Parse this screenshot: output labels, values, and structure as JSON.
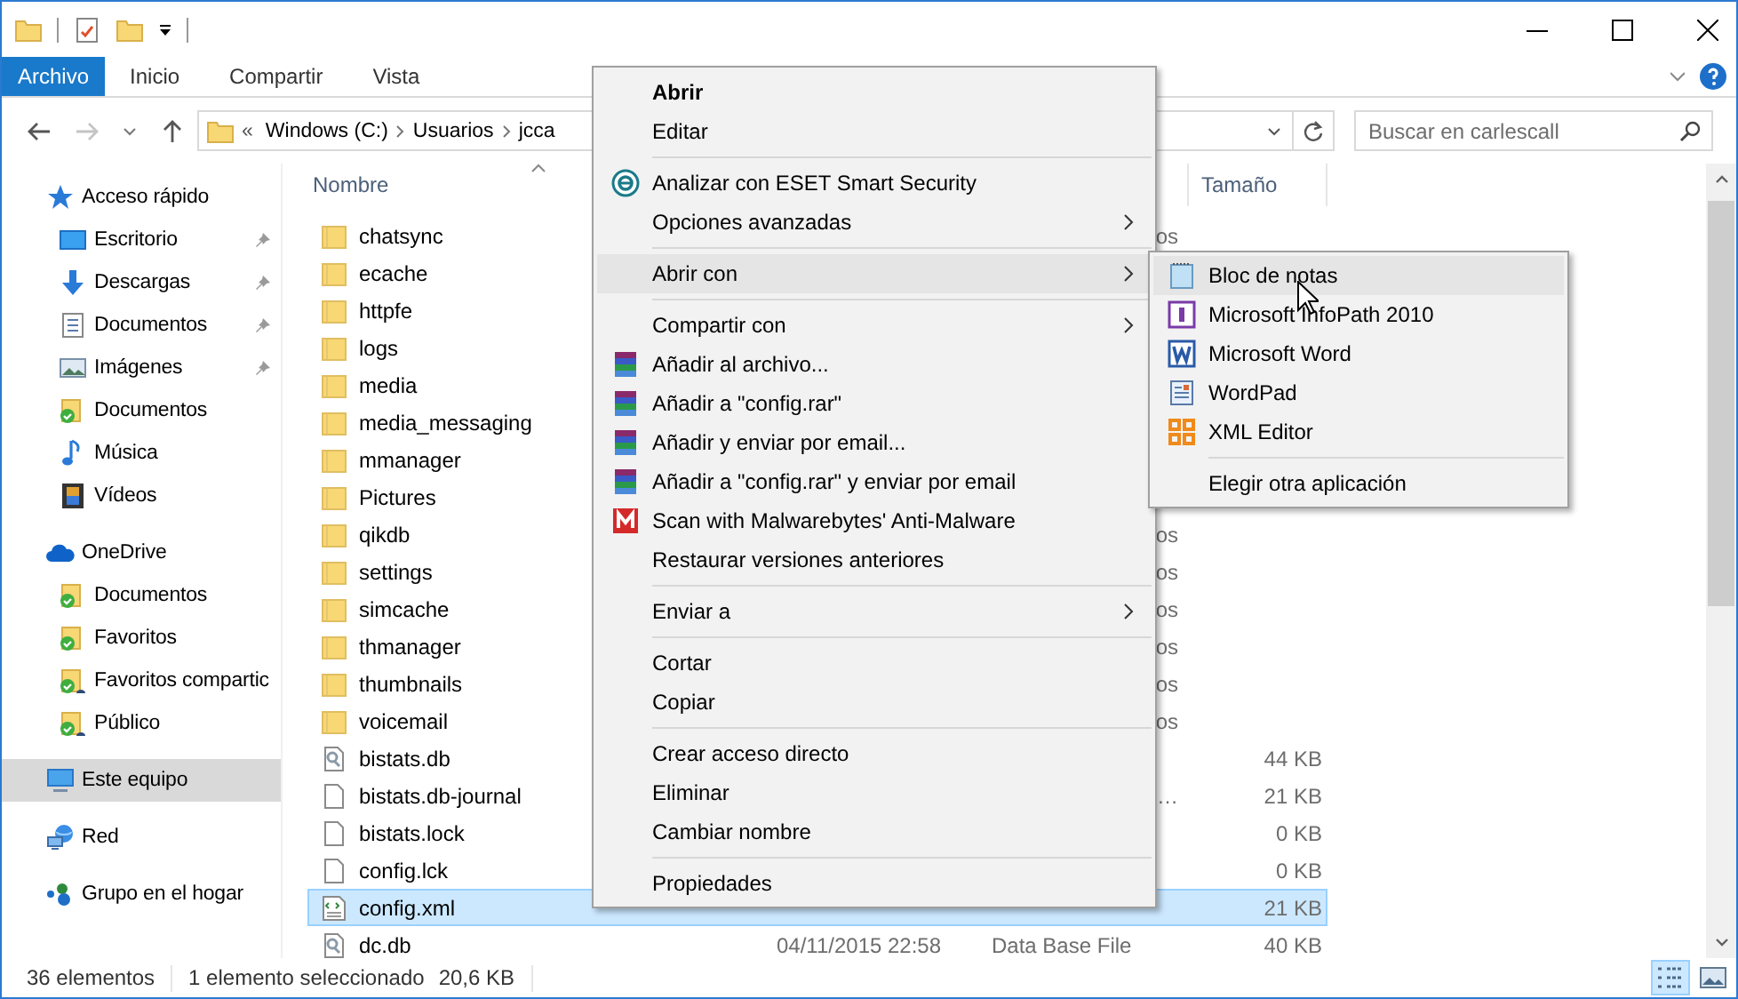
{
  "ribbon": {
    "tabs": [
      {
        "label": "Archivo",
        "selected": true
      },
      {
        "label": "Inicio",
        "selected": false
      },
      {
        "label": "Compartir",
        "selected": false
      },
      {
        "label": "Vista",
        "selected": false
      }
    ]
  },
  "address_bar": {
    "back": {
      "disabled": false
    },
    "forward": {
      "disabled": true
    },
    "overflow_mark": "«",
    "path": [
      "Windows (C:)",
      "Usuarios",
      "jcca"
    ]
  },
  "search": {
    "placeholder": "Buscar en carlescall"
  },
  "nav_pane": {
    "items": [
      {
        "label": "Acceso rápido",
        "kind": "star",
        "selected": false,
        "children": [
          {
            "label": "Escritorio",
            "kind": "desktop",
            "pinned": true,
            "selected": false
          },
          {
            "label": "Descargas",
            "kind": "download",
            "pinned": true,
            "selected": false
          },
          {
            "label": "Documentos",
            "kind": "documents",
            "pinned": true,
            "selected": false
          },
          {
            "label": "Imágenes",
            "kind": "images",
            "pinned": true,
            "selected": false
          },
          {
            "label": "Documentos",
            "kind": "synced",
            "pinned": false,
            "selected": false
          },
          {
            "label": "Música",
            "kind": "music",
            "pinned": false,
            "selected": false
          },
          {
            "label": "Vídeos",
            "kind": "video",
            "pinned": false,
            "selected": false
          }
        ]
      },
      {
        "label": "OneDrive",
        "kind": "cloud",
        "selected": false,
        "children": [
          {
            "label": "Documentos",
            "kind": "synced",
            "pinned": false,
            "selected": false
          },
          {
            "label": "Favoritos",
            "kind": "synced",
            "pinned": false,
            "selected": false
          },
          {
            "label": "Favoritos compartic",
            "kind": "shared",
            "pinned": false,
            "selected": false
          },
          {
            "label": "Público",
            "kind": "shared",
            "pinned": false,
            "selected": false
          }
        ]
      },
      {
        "label": "Este equipo",
        "kind": "computer",
        "selected": true
      },
      {
        "label": "Red",
        "kind": "network",
        "selected": false
      },
      {
        "label": "Grupo en el hogar",
        "kind": "homegroup",
        "selected": false
      }
    ]
  },
  "file_list": {
    "columns": [
      {
        "label": "Nombre",
        "sorted": true
      },
      {
        "label": "Tamaño",
        "sorted": false
      }
    ],
    "rows": [
      {
        "name": "chatsync",
        "kind": "folder",
        "selected": false,
        "type_tail": "os"
      },
      {
        "name": "ecache",
        "kind": "folder",
        "selected": false
      },
      {
        "name": "httpfe",
        "kind": "folder",
        "selected": false
      },
      {
        "name": "logs",
        "kind": "folder",
        "selected": false
      },
      {
        "name": "media",
        "kind": "folder",
        "selected": false
      },
      {
        "name": "media_messaging",
        "kind": "folder",
        "selected": false
      },
      {
        "name": "mmanager",
        "kind": "folder",
        "selected": false
      },
      {
        "name": "Pictures",
        "kind": "folder",
        "selected": false
      },
      {
        "name": "qikdb",
        "kind": "folder",
        "selected": false,
        "type_tail": "os"
      },
      {
        "name": "settings",
        "kind": "folder",
        "selected": false,
        "type_tail": "os"
      },
      {
        "name": "simcache",
        "kind": "folder",
        "selected": false,
        "type_tail": "os"
      },
      {
        "name": "thmanager",
        "kind": "folder",
        "selected": false,
        "type_tail": "os"
      },
      {
        "name": "thumbnails",
        "kind": "folder",
        "selected": false,
        "type_tail": "os"
      },
      {
        "name": "voicemail",
        "kind": "folder",
        "selected": false,
        "type_tail": "os"
      },
      {
        "name": "bistats.db",
        "kind": "database",
        "selected": false,
        "size": "44 KB"
      },
      {
        "name": "bistats.db-journal",
        "kind": "file",
        "selected": false,
        "type_tail": "…",
        "size": "21 KB"
      },
      {
        "name": "bistats.lock",
        "kind": "file",
        "selected": false,
        "size": "0 KB"
      },
      {
        "name": "config.lck",
        "kind": "file",
        "selected": false,
        "size": "0 KB"
      },
      {
        "name": "config.xml",
        "kind": "xml",
        "selected": true,
        "size": "21 KB"
      },
      {
        "name": "dc.db",
        "kind": "database",
        "selected": false,
        "modified": "04/11/2015 22:58",
        "type": "Data Base File",
        "size": "40 KB"
      }
    ]
  },
  "context_menu": {
    "items": [
      {
        "kind": "item",
        "label": "Abrir",
        "default": true,
        "selected": false,
        "has_submenu": false
      },
      {
        "kind": "item",
        "label": "Editar",
        "default": false,
        "selected": false,
        "has_submenu": false
      },
      {
        "kind": "separator"
      },
      {
        "kind": "eset",
        "label": "Analizar con ESET Smart Security",
        "default": false,
        "selected": false,
        "has_submenu": false
      },
      {
        "kind": "item",
        "label": "Opciones avanzadas",
        "default": false,
        "selected": false,
        "has_submenu": true
      },
      {
        "kind": "separator"
      },
      {
        "kind": "item",
        "label": "Abrir con",
        "default": false,
        "selected": true,
        "has_submenu": true
      },
      {
        "kind": "separator"
      },
      {
        "kind": "item",
        "label": "Compartir con",
        "default": false,
        "selected": false,
        "has_submenu": true
      },
      {
        "kind": "archive",
        "label": "Añadir al archivo...",
        "default": false,
        "selected": false,
        "has_submenu": false
      },
      {
        "kind": "archive",
        "label": "Añadir a \"config.rar\"",
        "default": false,
        "selected": false,
        "has_submenu": false
      },
      {
        "kind": "archive",
        "label": "Añadir y enviar por email...",
        "default": false,
        "selected": false,
        "has_submenu": false
      },
      {
        "kind": "archive",
        "label": "Añadir a \"config.rar\" y enviar por email",
        "default": false,
        "selected": false,
        "has_submenu": false
      },
      {
        "kind": "malware",
        "label": "Scan with Malwarebytes' Anti-Malware",
        "default": false,
        "selected": false,
        "has_submenu": false
      },
      {
        "kind": "item",
        "label": "Restaurar versiones anteriores",
        "default": false,
        "selected": false,
        "has_submenu": false
      },
      {
        "kind": "separator"
      },
      {
        "kind": "item",
        "label": "Enviar a",
        "default": false,
        "selected": false,
        "has_submenu": true
      },
      {
        "kind": "separator"
      },
      {
        "kind": "item",
        "label": "Cortar",
        "default": false,
        "selected": false,
        "has_submenu": false
      },
      {
        "kind": "item",
        "label": "Copiar",
        "default": false,
        "selected": false,
        "has_submenu": false
      },
      {
        "kind": "separator"
      },
      {
        "kind": "item",
        "label": "Crear acceso directo",
        "default": false,
        "selected": false,
        "has_submenu": false
      },
      {
        "kind": "item",
        "label": "Eliminar",
        "default": false,
        "selected": false,
        "has_submenu": false
      },
      {
        "kind": "item",
        "label": "Cambiar nombre",
        "default": false,
        "selected": false,
        "has_submenu": false
      },
      {
        "kind": "separator"
      },
      {
        "kind": "item",
        "label": "Propiedades",
        "default": false,
        "selected": false,
        "has_submenu": false
      }
    ]
  },
  "submenu": {
    "items": [
      {
        "kind": "notepad",
        "label": "Bloc de notas",
        "selected": true
      },
      {
        "kind": "infopath",
        "label": "Microsoft InfoPath 2010",
        "selected": false
      },
      {
        "kind": "word",
        "label": "Microsoft Word",
        "selected": false
      },
      {
        "kind": "wordpad",
        "label": "WordPad",
        "selected": false
      },
      {
        "kind": "xml-editor",
        "label": "XML Editor",
        "selected": false
      },
      {
        "kind": "separator"
      },
      {
        "kind": "item",
        "label": "Elegir otra aplicación",
        "selected": false
      }
    ]
  },
  "status_bar": {
    "item_count": "36 elementos",
    "selection": "1 elemento seleccionado",
    "selection_size": "20,6 KB",
    "views": [
      {
        "kind": "details",
        "selected": true
      },
      {
        "kind": "large-icons",
        "selected": false
      }
    ]
  }
}
